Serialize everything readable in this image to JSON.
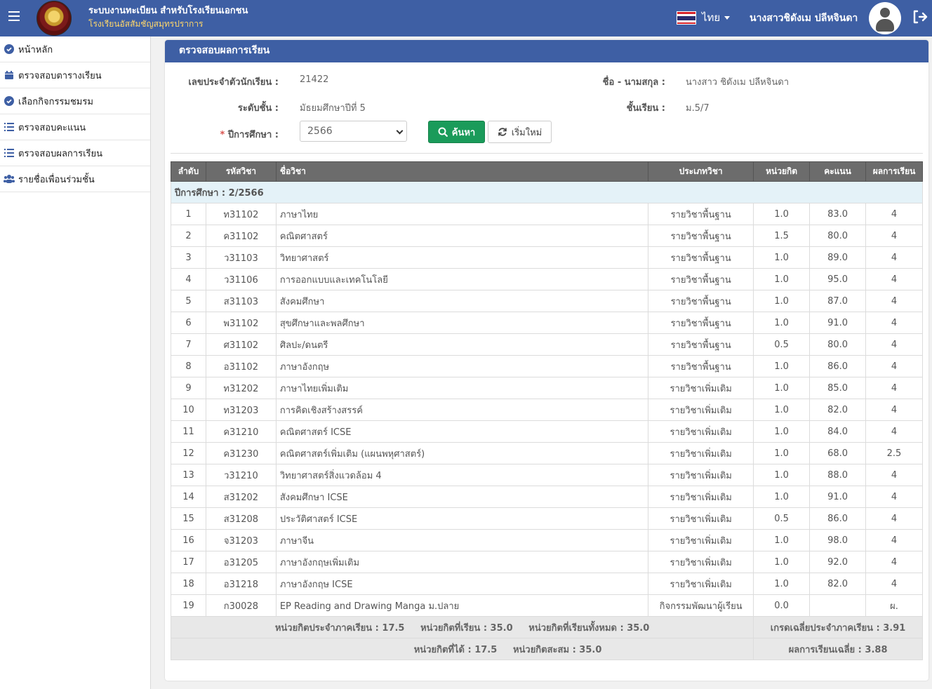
{
  "header": {
    "title": "ระบบงานทะเบียน สำหรับโรงเรียนเอกชน",
    "school": "โรงเรียนอัสสัมชัญสมุทรปราการ",
    "language": "ไทย",
    "user": "นางสาวชิดังเม ปลีหจินดา"
  },
  "sidebar": {
    "items": [
      {
        "label": "หน้าหลัก",
        "icon": "check-circle-icon"
      },
      {
        "label": "ตรวจสอบตารางเรียน",
        "icon": "calendar-icon"
      },
      {
        "label": "เลือกกิจกรรมชมรม",
        "icon": "check-circle-icon"
      },
      {
        "label": "ตรวจสอบคะแนน",
        "icon": "list-icon"
      },
      {
        "label": "ตรวจสอบผลการเรียน",
        "icon": "list-icon"
      },
      {
        "label": "รายชื่อเพื่อนร่วมชั้น",
        "icon": "users-icon"
      }
    ]
  },
  "panel": {
    "title": "ตรวจสอบผลการเรียน",
    "student_id_label": "เลขประจำตัวนักเรียน :",
    "student_id": "21422",
    "name_label": "ชื่อ - นามสกุล :",
    "name": "นางสาว ชิดังเม ปลีหจินดา",
    "level_label": "ระดับชั้น :",
    "level": "มัธยมศึกษาปีที่ 5",
    "class_label": "ชั้นเรียน :",
    "class": "ม.5/7",
    "year_required": "*",
    "year_label": "ปีการศึกษา :",
    "year_value": "2566",
    "search_label": "ค้นหา",
    "reset_label": "เริ่มใหม่"
  },
  "table": {
    "headers": [
      "ลำดับ",
      "รหัสวิชา",
      "ชื่อวิชา",
      "ประเภทวิชา",
      "หน่วยกิต",
      "คะแนน",
      "ผลการเรียน"
    ],
    "term_label": "ปีการศึกษา : 2/2566",
    "rows": [
      [
        "1",
        "ท31102",
        "ภาษาไทย",
        "รายวิชาพื้นฐาน",
        "1.0",
        "83.0",
        "4"
      ],
      [
        "2",
        "ค31102",
        "คณิตศาสตร์",
        "รายวิชาพื้นฐาน",
        "1.5",
        "80.0",
        "4"
      ],
      [
        "3",
        "ว31103",
        "วิทยาศาสตร์",
        "รายวิชาพื้นฐาน",
        "1.0",
        "89.0",
        "4"
      ],
      [
        "4",
        "ว31106",
        "การออกแบบและเทคโนโลยี",
        "รายวิชาพื้นฐาน",
        "1.0",
        "95.0",
        "4"
      ],
      [
        "5",
        "ส31103",
        "สังคมศึกษา",
        "รายวิชาพื้นฐาน",
        "1.0",
        "87.0",
        "4"
      ],
      [
        "6",
        "พ31102",
        "สุขศึกษาและพลศึกษา",
        "รายวิชาพื้นฐาน",
        "1.0",
        "91.0",
        "4"
      ],
      [
        "7",
        "ศ31102",
        "ศิลปะ/ดนตรี",
        "รายวิชาพื้นฐาน",
        "0.5",
        "80.0",
        "4"
      ],
      [
        "8",
        "อ31102",
        "ภาษาอังกฤษ",
        "รายวิชาพื้นฐาน",
        "1.0",
        "86.0",
        "4"
      ],
      [
        "9",
        "ท31202",
        "ภาษาไทยเพิ่มเติม",
        "รายวิชาเพิ่มเติม",
        "1.0",
        "85.0",
        "4"
      ],
      [
        "10",
        "ท31203",
        "การคิดเชิงสร้างสรรค์",
        "รายวิชาเพิ่มเติม",
        "1.0",
        "82.0",
        "4"
      ],
      [
        "11",
        "ค31210",
        "คณิตศาสตร์ ICSE",
        "รายวิชาเพิ่มเติม",
        "1.0",
        "84.0",
        "4"
      ],
      [
        "12",
        "ค31230",
        "คณิตศาสตร์เพิ่มเติม (แผนพหุศาสตร์)",
        "รายวิชาเพิ่มเติม",
        "1.0",
        "68.0",
        "2.5"
      ],
      [
        "13",
        "ว31210",
        "วิทยาศาสตร์สิ่งแวดล้อม 4",
        "รายวิชาเพิ่มเติม",
        "1.0",
        "88.0",
        "4"
      ],
      [
        "14",
        "ส31202",
        "สังคมศึกษา ICSE",
        "รายวิชาเพิ่มเติม",
        "1.0",
        "91.0",
        "4"
      ],
      [
        "15",
        "ส31208",
        "ประวัติศาสตร์ ICSE",
        "รายวิชาเพิ่มเติม",
        "0.5",
        "86.0",
        "4"
      ],
      [
        "16",
        "จ31203",
        "ภาษาจีน",
        "รายวิชาเพิ่มเติม",
        "1.0",
        "98.0",
        "4"
      ],
      [
        "17",
        "อ31205",
        "ภาษาอังกฤษเพิ่มเติม",
        "รายวิชาเพิ่มเติม",
        "1.0",
        "92.0",
        "4"
      ],
      [
        "18",
        "อ31218",
        "ภาษาอังกฤษ ICSE",
        "รายวิชาเพิ่มเติม",
        "1.0",
        "82.0",
        "4"
      ],
      [
        "19",
        "ก30028",
        "EP Reading and Drawing Manga ม.ปลาย",
        "กิจกรรมพัฒนาผู้เรียน",
        "0.0",
        "",
        "ผ."
      ]
    ],
    "summary": {
      "term_credits": "หน่วยกิตประจำภาคเรียน : 17.5",
      "credits_studied": "หน่วยกิตที่เรียน : 35.0",
      "credits_total": "หน่วยกิตที่เรียนทั้งหมด : 35.0",
      "term_gpa": "เกรดเฉลี่ยประจำภาคเรียน : 3.91",
      "credits_earned": "หน่วยกิตที่ได้ : 17.5",
      "credits_accum": "หน่วยกิตสะสม : 35.0",
      "gpax": "ผลการเรียนเฉลี่ย : 3.88"
    }
  },
  "colors": {
    "header_blue": "#3e5fa4",
    "search_green": "#1a9b5a",
    "table_header": "#6c6c6c",
    "term_row": "#e4f2f8"
  }
}
